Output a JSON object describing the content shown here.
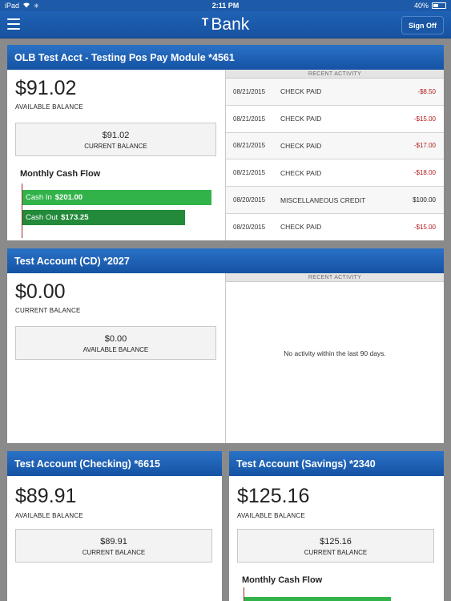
{
  "status": {
    "device": "iPad",
    "time": "2:11 PM",
    "battery": "40%",
    "battery_level": 0.4
  },
  "header": {
    "logo_mark": "ᵀ",
    "logo_text": "Bank",
    "sign_off": "Sign Off"
  },
  "accounts": [
    {
      "title": "OLB Test Acct - Testing Pos Pay Module *4561",
      "primary_amount": "$91.02",
      "primary_label": "AVAILABLE BALANCE",
      "secondary_amount": "$91.02",
      "secondary_label": "CURRENT BALANCE",
      "cash_flow": {
        "title": "Monthly Cash Flow",
        "in_label": "Cash In",
        "in_value": "$201.00",
        "in_amount": 201.0,
        "out_label": "Cash Out",
        "out_value": "$173.25",
        "out_amount": 173.25
      },
      "recent_activity_label": "RECENT ACTIVITY",
      "activity": [
        {
          "date": "08/21/2015",
          "desc": "CHECK PAID",
          "amount": "-$8.50"
        },
        {
          "date": "08/21/2015",
          "desc": "CHECK PAID",
          "amount": "-$15.00"
        },
        {
          "date": "08/21/2015",
          "desc": "CHECK PAID",
          "amount": "-$17.00"
        },
        {
          "date": "08/21/2015",
          "desc": "CHECK PAID",
          "amount": "-$18.00"
        },
        {
          "date": "08/20/2015",
          "desc": "MISCELLANEOUS CREDIT",
          "amount": "$100.00"
        },
        {
          "date": "08/20/2015",
          "desc": "CHECK PAID",
          "amount": "-$15.00"
        }
      ]
    },
    {
      "title": "Test Account (CD) *2027",
      "primary_amount": "$0.00",
      "primary_label": "CURRENT BALANCE",
      "secondary_amount": "$0.00",
      "secondary_label": "AVAILABLE BALANCE",
      "recent_activity_label": "RECENT ACTIVITY",
      "no_activity": "No activity within the last 90 days."
    },
    {
      "title": "Test Account (Checking) *6615",
      "primary_amount": "$89.91",
      "primary_label": "AVAILABLE BALANCE",
      "secondary_amount": "$89.91",
      "secondary_label": "CURRENT BALANCE"
    },
    {
      "title": "Test Account (Savings) *2340",
      "primary_amount": "$125.16",
      "primary_label": "AVAILABLE BALANCE",
      "secondary_amount": "$125.16",
      "secondary_label": "CURRENT BALANCE",
      "cash_flow": {
        "title": "Monthly Cash Flow"
      }
    }
  ],
  "colors": {
    "header_blue": "#1d5aa8",
    "cash_in": "#31b34a",
    "cash_out": "#228a39",
    "debit": "#b01a1a"
  }
}
